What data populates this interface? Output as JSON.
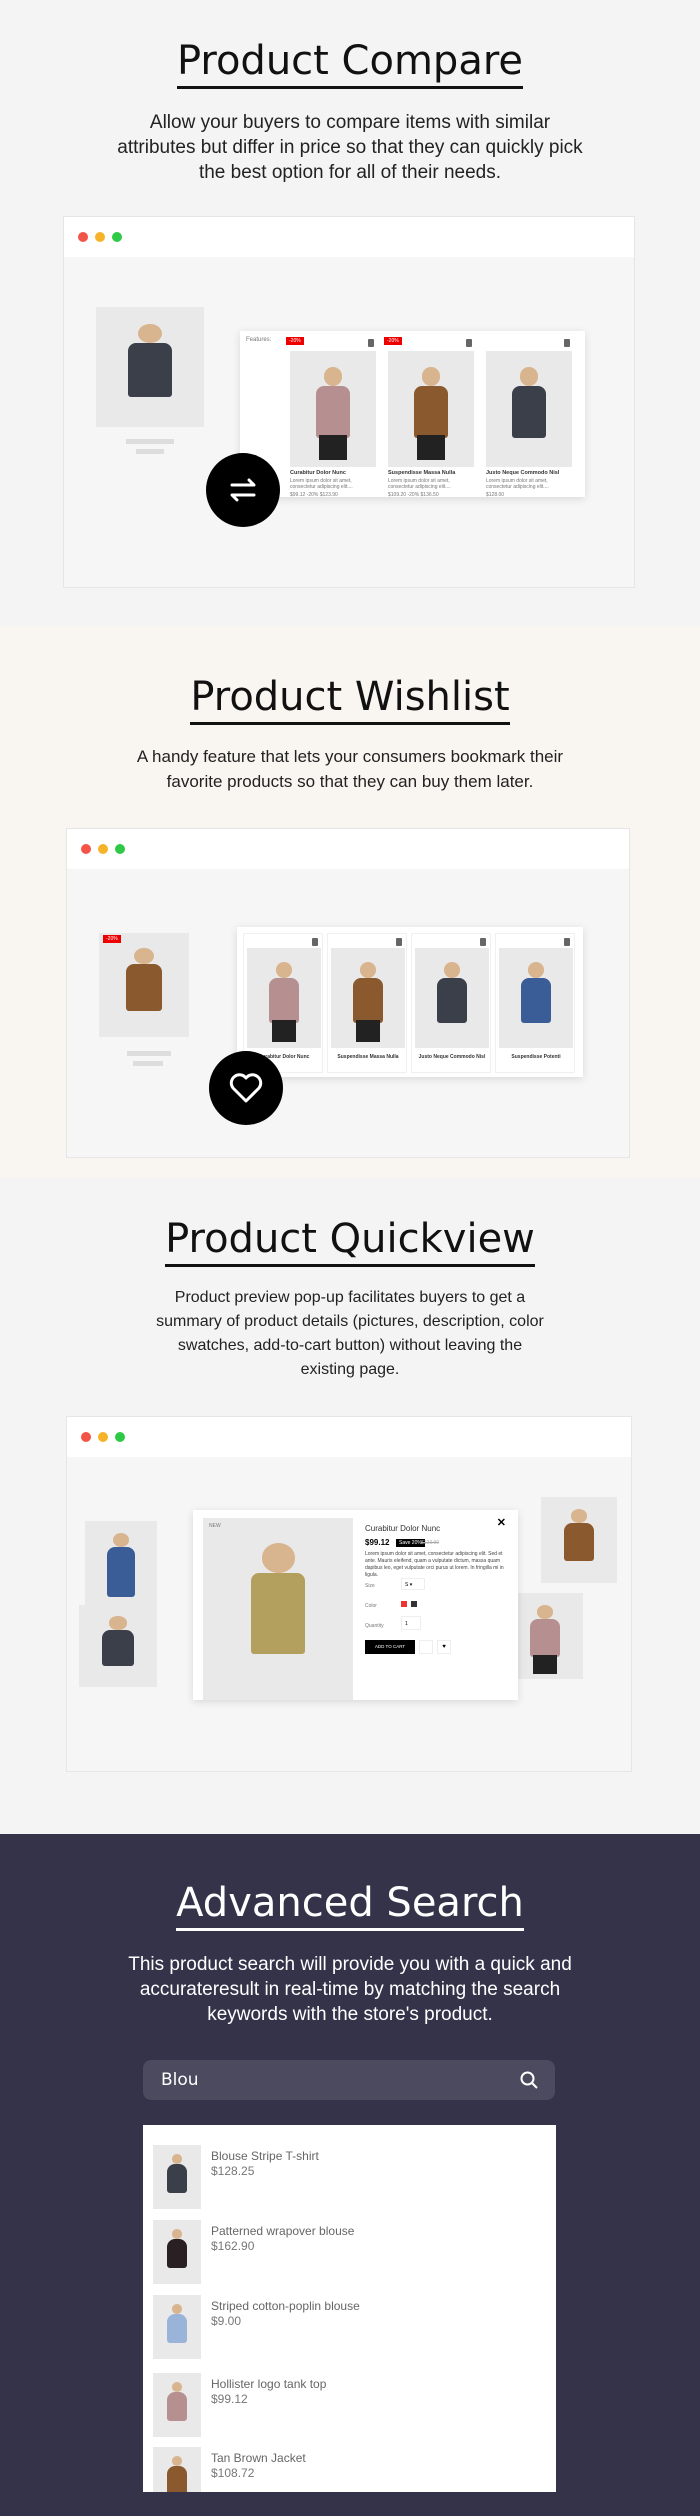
{
  "colors": {
    "dot_red": "#f25548",
    "dot_yellow": "#f6b32a",
    "dot_green": "#2ec946",
    "search_bg": "#34334a",
    "sale": "#e00000"
  },
  "compare": {
    "title": "Product Compare",
    "description": "Allow your buyers to compare items with similar attributes but differ in price so that they can quickly pick the best option for all of their needs.",
    "features_label": "Features:",
    "badge": "-20%",
    "icon": "compare-arrows-icon",
    "products": [
      {
        "name": "Curabitur Dolor Nunc",
        "desc": "Lorem ipsum dolor sit amet, consectetur adipiscing elit....",
        "price": "$99.12 -20% $123.90"
      },
      {
        "name": "Suspendisse Massa Nulla",
        "desc": "Lorem ipsum dolor sit amet, consectetur adipiscing elit....",
        "price": "$109.20 -20% $136.50"
      },
      {
        "name": "Justo Neque Commodo Nisl",
        "desc": "Lorem ipsum dolor sit amet, consectetur adipiscing elit....",
        "price": "$128.00"
      }
    ]
  },
  "wishlist": {
    "title": "Product Wishlist",
    "description": "A handy feature that lets your consumers bookmark their favorite products so that they can buy them later.",
    "icon": "heart-icon",
    "products": [
      "Curabitur Dolor Nunc",
      "Suspendisse Massa Nulla",
      "Justo Neque Commodo Nisl",
      "Suspendisse Potenti"
    ]
  },
  "quickview": {
    "title": "Product Quickview",
    "description": "Product preview pop-up facilitates buyers to get a summary of product details (pictures, description, color swatches, add-to-cart button) without leaving the existing page.",
    "badge": "NEW",
    "name": "Curabitur Dolor Nunc",
    "price": "$99.12",
    "save": "Save 20%",
    "old_price": "$123.90",
    "text": "Lorem ipsum dolor sit amet, consectetur adipiscing elit. Sed et ante. Mauris eleifend, quam a vulputate dictum, massa quam dapibus leo, eget vulputate orci purus ut lorem. In fringilla mi in ligula.",
    "size_label": "Size",
    "size_value": "S",
    "color_label": "Color",
    "quantity_label": "Quantity",
    "quantity_value": "1",
    "add_to_cart": "ADD TO CART",
    "close": "✕"
  },
  "search": {
    "title": "Advanced Search",
    "description": "This product search will provide you with a quick and accurateresult in real-time by matching the search keywords with the store's product.",
    "query": "Blou",
    "results": [
      {
        "name": "Blouse Stripe T-shirt",
        "price": "$128.25"
      },
      {
        "name": "Patterned wrapover blouse",
        "price": "$162.90"
      },
      {
        "name": "Striped cotton-poplin blouse",
        "price": "$9.00"
      },
      {
        "name": "Hollister logo tank top",
        "price": "$99.12"
      },
      {
        "name": "Tan Brown Jacket",
        "price": "$108.72"
      }
    ]
  }
}
